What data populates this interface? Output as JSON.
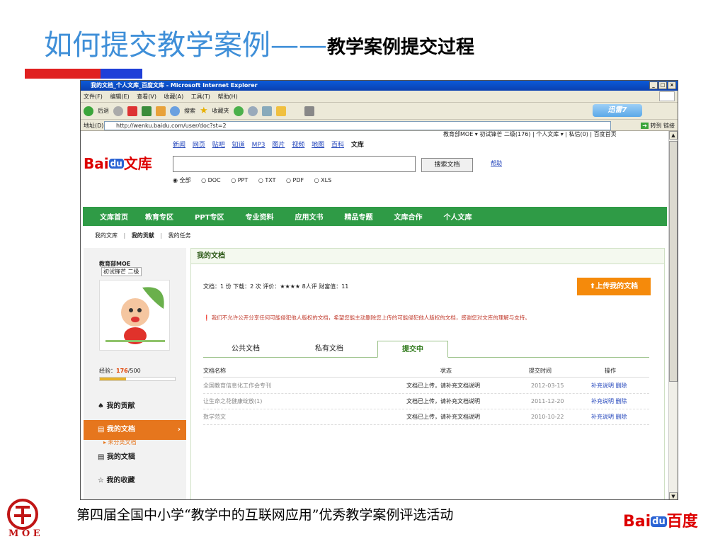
{
  "slide": {
    "title_main": "如何提交教学案例",
    "title_dash": "——",
    "title_sub": "教学案例提交过程",
    "footer": "第四届全国中小学“教学中的互联网应用”优秀教学案例评选活动",
    "moe_text": "M O E",
    "baidu_footer_bai": "Bai",
    "baidu_footer_du": "du",
    "baidu_footer_cn": "百度"
  },
  "browser": {
    "window_title": "我的文档_个人文库_百度文库 - Microsoft Internet Explorer",
    "menu": [
      "文件(F)",
      "编辑(E)",
      "查看(V)",
      "收藏(A)",
      "工具(T)",
      "帮助(H)"
    ],
    "toolbar": {
      "back": "后退",
      "search": "搜索",
      "favorites": "收藏夹",
      "xunlei": "迅雷7"
    },
    "address_label": "地址(D)",
    "address": "http://wenku.baidu.com/user/doc?st=2",
    "go": "转到",
    "links": "链接"
  },
  "site": {
    "top_nav": [
      "新闻",
      "网页",
      "贴吧",
      "知道",
      "MP3",
      "图片",
      "视频",
      "地图",
      "百科",
      "文库"
    ],
    "user_bar": "教育部MOE ▾ 初试锋芒 二级(176) | 个人文库 ▾ | 私信(0) | 百度首页",
    "logo_bai": "Bai",
    "logo_du": "du",
    "logo_wenku": "文库",
    "search_button": "搜索文档",
    "help": "帮助",
    "radios": [
      "◉ 全部",
      "○ DOC",
      "○ PPT",
      "○ TXT",
      "○ PDF",
      "○ XLS"
    ],
    "green_nav": [
      "文库首页",
      "教育专区",
      "PPT专区",
      "专业资料",
      "应用文书",
      "精品专题",
      "文库合作",
      "个人文库"
    ],
    "sub_nav": [
      "我的文库",
      "|",
      "我的贡献",
      "|",
      "我的任务"
    ]
  },
  "sidebar": {
    "username": "教育部MOE",
    "level": "初试锋芒",
    "level_num": "二级",
    "exp_label": "经验：",
    "exp_value": "176",
    "exp_max": "/500",
    "exp_progress": 0.352,
    "nav": [
      "♠ 我的贡献",
      "▤ 我的文档",
      "▸ 未分类文档",
      "▤ 我的文辑",
      "☆ 我的收藏"
    ],
    "nav_arrow": "›"
  },
  "main": {
    "header": "我的文档",
    "stats": "文档：1 份    下载：2 次    评价：★★★★  8人评    财富值：11",
    "upload": "⬆上传我的文档",
    "notice": "❗ 我们不允许公开分享任何可能侵犯他人版权的文档，希望您能主动删除您上传的可能侵犯他人版权的文档，感谢您对文库的理解与支持。",
    "tabs": [
      "公共文档",
      "私有文档",
      "提交中"
    ],
    "table_headers": [
      "文档名称",
      "状态",
      "提交时间",
      "操作"
    ],
    "rows": [
      {
        "name": "全国教育信息化工作会专刊",
        "status": "文档已上传，请补充文档说明",
        "date": "2012-03-15",
        "actions": "补充说明  删除"
      },
      {
        "name": "让生命之花健康绽放(1)",
        "status": "文档已上传，请补充文档说明",
        "date": "2011-12-20",
        "actions": "补充说明  删除"
      },
      {
        "name": "数学范文",
        "status": "文档已上传，请补充文档说明",
        "date": "2010-10-22",
        "actions": "补充说明  删除"
      }
    ]
  },
  "colors": {
    "title_blue": "#3f8fd8",
    "green_nav": "#2f9b46",
    "orange": "#f58a0b",
    "baidu_red": "#d00"
  }
}
